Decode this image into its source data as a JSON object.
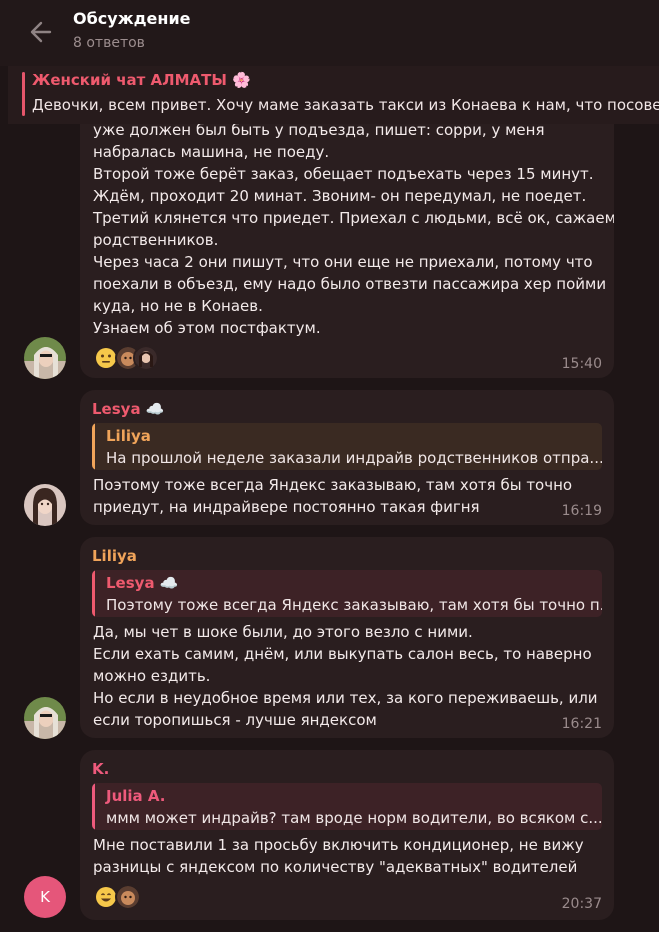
{
  "header": {
    "title": "Обсуждение",
    "subtitle": "8 ответов"
  },
  "pinned": {
    "title": "Женский чат АЛМАТЫ 🌸",
    "text": "Девочки, всем привет. Хочу маме заказать такси из Конаева к нам, что посоветуете"
  },
  "messages": [
    {
      "lines": [
        "уже должен был быть у подъезда, пишет: сорри, у меня",
        "набралась машина, не поеду.",
        "Второй тоже берёт заказ, обещает подъехать через 15 минут.",
        "Ждём, проходит 20 минат. Звоним- он передумал, не поедет.",
        "Третий клянется что приедет. Приехал с людьми, всё ок, сажаем",
        "родственников.",
        "Через часа 2 они пишут, что они еще не приехали, потому что",
        "поехали в объезд, ему надо было отвезти пассажира хер пойми",
        "куда, но не в Конаев.",
        "Узнаем об этом постфактум."
      ],
      "time": "15:40",
      "reactions": [
        "neutral-face-emoji",
        "user-avatar",
        "user-avatar"
      ]
    },
    {
      "sender": "Lesya ☁️",
      "sender_color": "#ee5a6e",
      "reply_name": "Liliya",
      "reply_text": "На прошлой неделе заказали индрайв родственников отпра...",
      "reply_color": "#f0a45a",
      "lines": [
        "Поэтому тоже всегда Яндекс заказываю, там хотя бы точно",
        "приедут, на индрайвере постоянно такая фигня"
      ],
      "time": "16:19"
    },
    {
      "sender": "Liliya",
      "sender_color": "#f0a45a",
      "reply_name": "Lesya ☁️",
      "reply_text": "Поэтому тоже всегда Яндекс заказываю, там хотя бы точно п...",
      "reply_color": "#ee5a6e",
      "lines": [
        "Да, мы чет в шоке были, до этого везло с ними.",
        "Если ехать самим, днём, или выкупать салон весь, то наверно",
        "можно ездить.",
        "Но если в неудобное время или тех, за кого переживаешь, или",
        "если торопишься - лучше яндексом"
      ],
      "time": "16:21"
    },
    {
      "sender": "K.",
      "sender_color": "#ee5a7c",
      "reply_name": "Julia A.",
      "reply_text": "ммм может индрайв? там вроде норм водители, во всяком с...",
      "reply_color": "#ee5a7c",
      "lines": [
        "Мне поставили 1 за просьбу включить кондиционер, не вижу",
        "разницы с яндексом по количеству \"адекватных\" водителей"
      ],
      "time": "20:37",
      "avatar_letter": "K",
      "reactions": [
        "grinning-face-emoji",
        "user-avatar"
      ]
    }
  ],
  "colors": {
    "background": "#1e1516",
    "bubble": "#2a1e1f",
    "accent_red": "#ee5a6e",
    "accent_orange": "#f0a45a",
    "time": "#9a8b8c"
  }
}
